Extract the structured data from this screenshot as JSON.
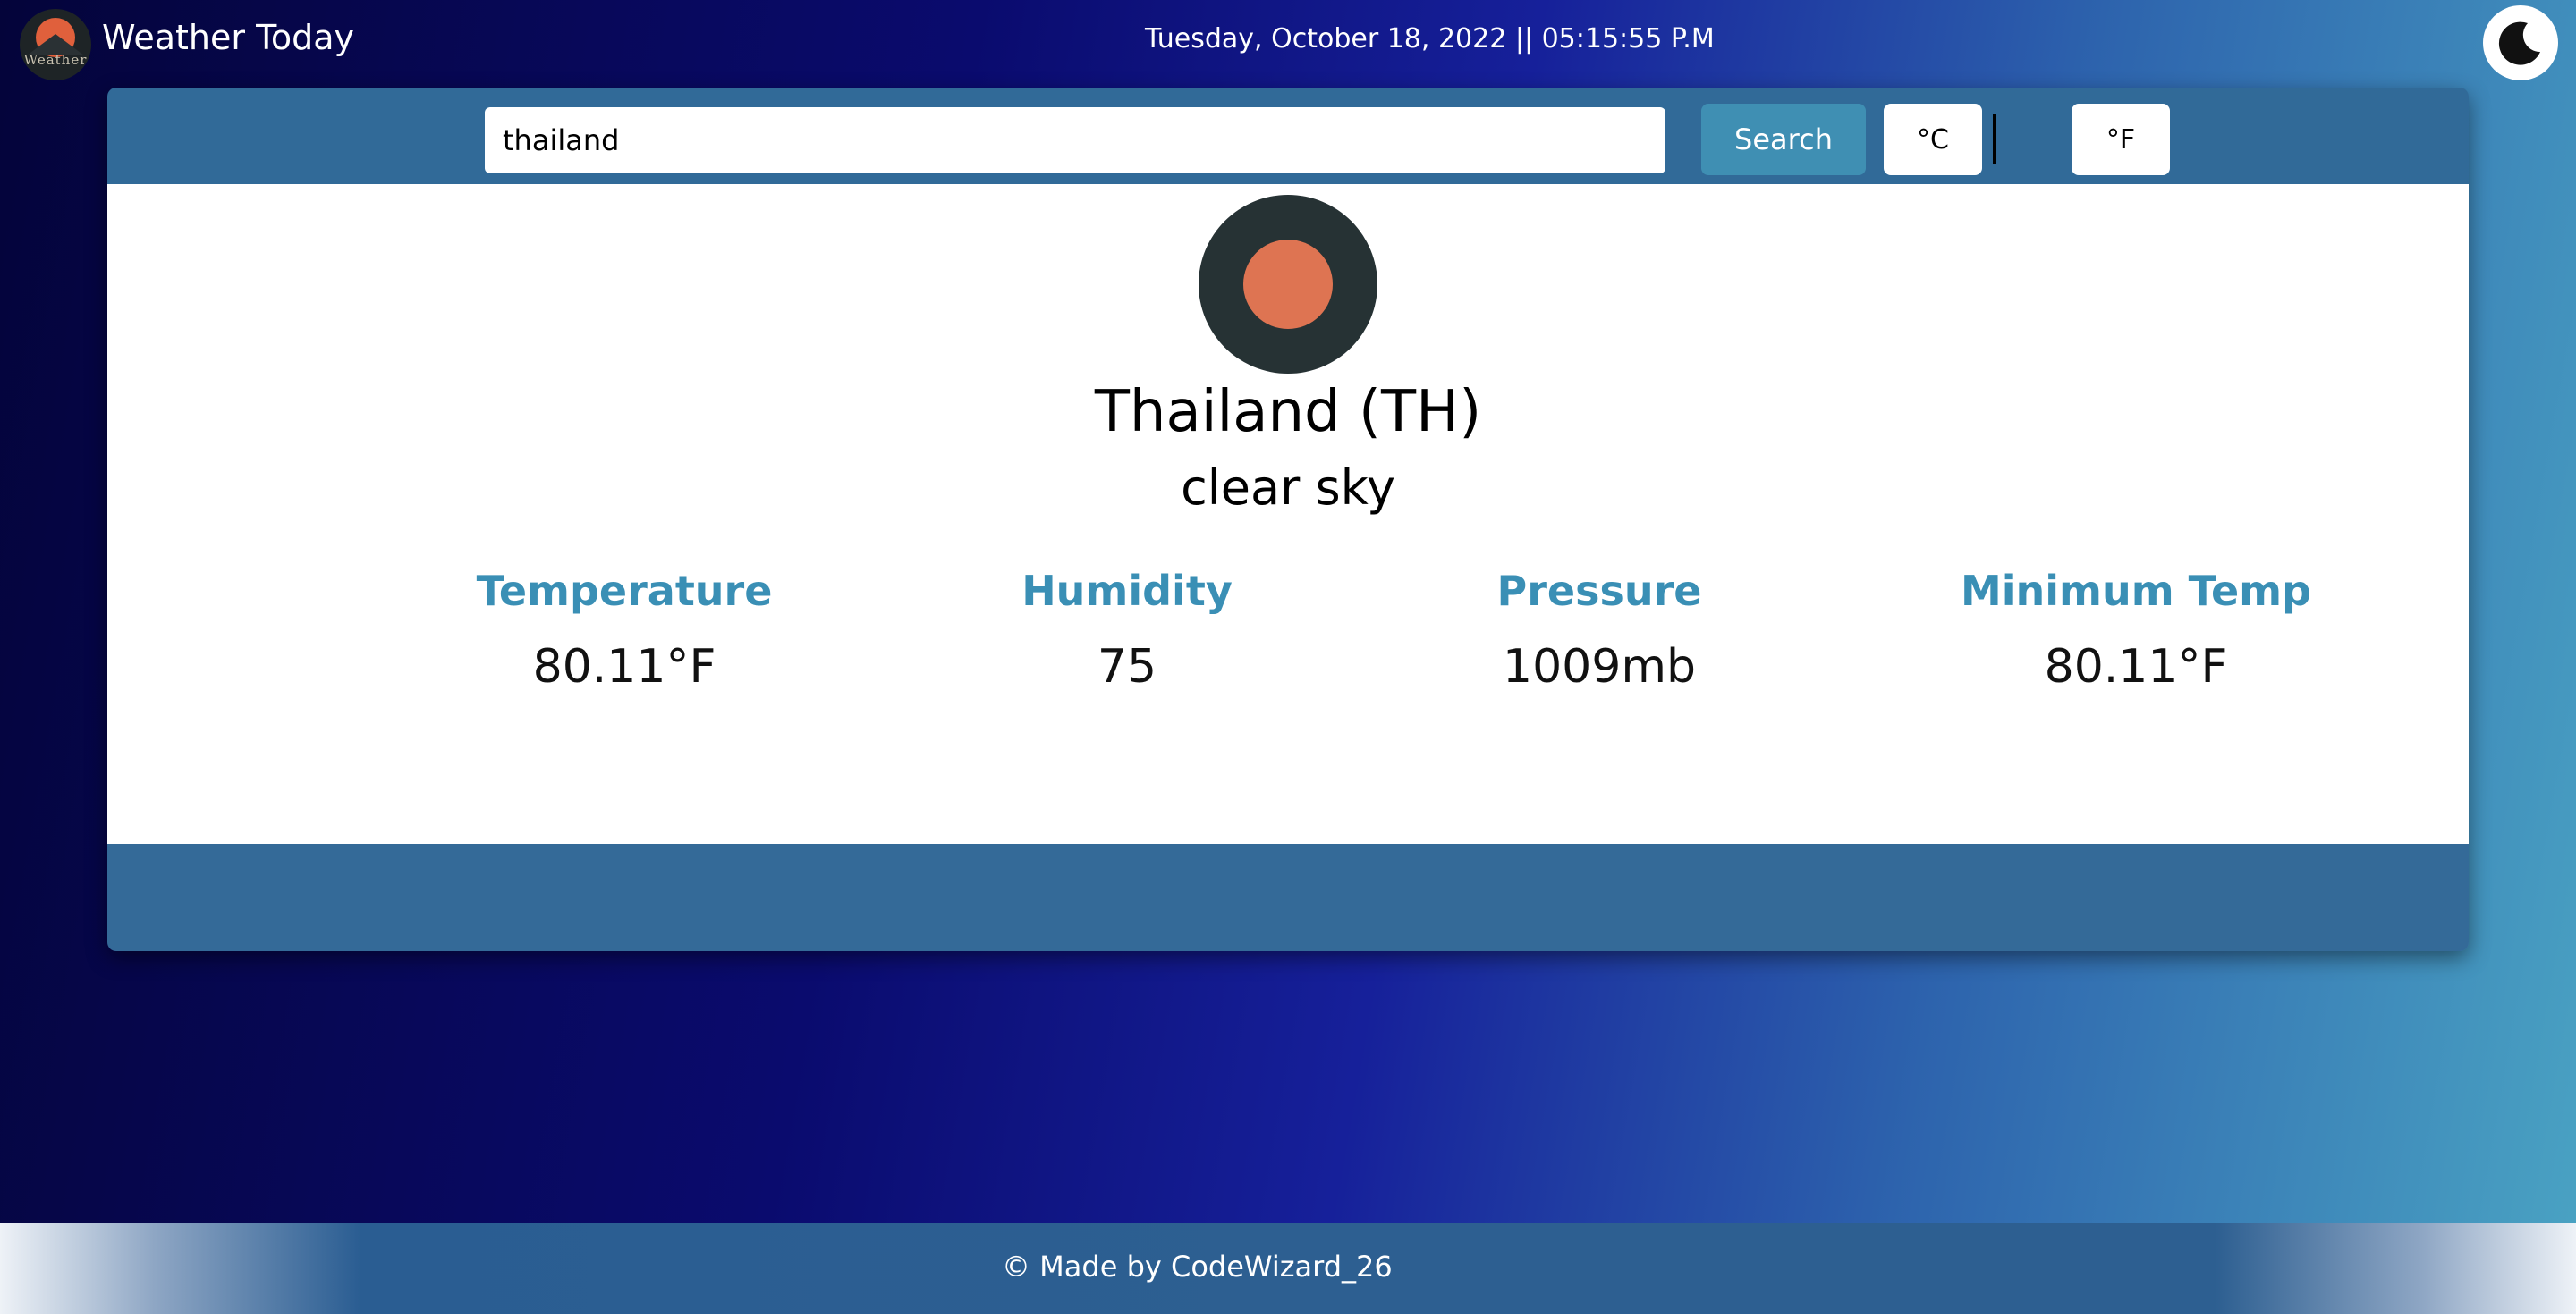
{
  "header": {
    "logo_text": "Weather",
    "title": "Weather Today",
    "datetime": "Tuesday, October 18, 2022 || 05:15:55 P.M",
    "theme_toggle_icon": "moon-icon"
  },
  "search": {
    "value": "thailand",
    "button_label": "Search",
    "unit_celsius": "°C",
    "unit_fahrenheit": "°F"
  },
  "weather": {
    "icon": "clear-sky-sun-icon",
    "location": "Thailand (TH)",
    "condition": "clear sky",
    "stats": [
      {
        "label": "Temperature",
        "value": "80.11°F"
      },
      {
        "label": "Humidity",
        "value": "75"
      },
      {
        "label": "Pressure",
        "value": "1009mb"
      },
      {
        "label": "Minimum Temp",
        "value": "80.11°F"
      }
    ]
  },
  "footer": {
    "text": "© Made by CodeWizard_26"
  },
  "colors": {
    "accent": "#3f8fb3",
    "card_band": "#316a98",
    "stat_label": "#3a8fb5",
    "sun": "#de7452"
  }
}
